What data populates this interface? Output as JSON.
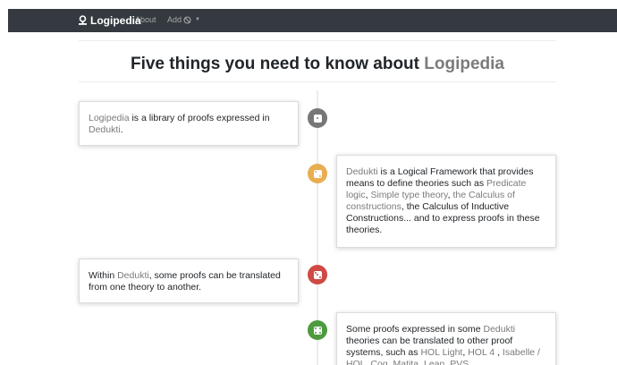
{
  "nav": {
    "brand": "Logipedia",
    "about": "About",
    "add": "Add"
  },
  "title": {
    "prefix": "Five things you need to know about ",
    "accent": "Logipedia"
  },
  "items": [
    {
      "color": "#777777",
      "icon": "dice-one-icon",
      "parts": [
        {
          "t": "Logipedia",
          "link": true
        },
        {
          "t": " is a library of proofs expressed in ",
          "link": false
        },
        {
          "t": "Dedukti",
          "link": true
        },
        {
          "t": ".",
          "link": false
        }
      ]
    },
    {
      "color": "#e9ad52",
      "icon": "dice-two-icon",
      "parts": [
        {
          "t": "Dedukti",
          "link": true
        },
        {
          "t": " is a Logical Framework that provides means to define theories such as ",
          "link": false
        },
        {
          "t": "Predicate logic",
          "link": true
        },
        {
          "t": ", ",
          "link": false
        },
        {
          "t": "Simple type theory",
          "link": true
        },
        {
          "t": ", ",
          "link": false
        },
        {
          "t": "the Calculus of constructions",
          "link": true
        },
        {
          "t": ", the Calculus of Inductive Constructions... and to express proofs in these theories.",
          "link": false
        }
      ]
    },
    {
      "color": "#cf4a44",
      "icon": "dice-three-icon",
      "parts": [
        {
          "t": "Within ",
          "link": false
        },
        {
          "t": "Dedukti",
          "link": true
        },
        {
          "t": ", some proofs can be translated from one theory to another.",
          "link": false
        }
      ]
    },
    {
      "color": "#4d9a3f",
      "icon": "dice-four-icon",
      "parts": [
        {
          "t": "Some proofs expressed in some ",
          "link": false
        },
        {
          "t": "Dedukti",
          "link": true
        },
        {
          "t": " theories can be translated to other proof systems, such as ",
          "link": false
        },
        {
          "t": "HOL Light",
          "link": true
        },
        {
          "t": ", ",
          "link": false
        },
        {
          "t": "HOL 4",
          "link": true
        },
        {
          "t": " , ",
          "link": false
        },
        {
          "t": "Isabelle / HOL",
          "link": true
        },
        {
          "t": ", ",
          "link": false
        },
        {
          "t": "Coq",
          "link": true
        },
        {
          "t": ", ",
          "link": false
        },
        {
          "t": "Matita",
          "link": true
        },
        {
          "t": ", ",
          "link": false
        },
        {
          "t": "Lean",
          "link": true
        },
        {
          "t": ", ",
          "link": false
        },
        {
          "t": "PVS",
          "link": true
        },
        {
          "t": "...",
          "link": false
        }
      ]
    }
  ]
}
